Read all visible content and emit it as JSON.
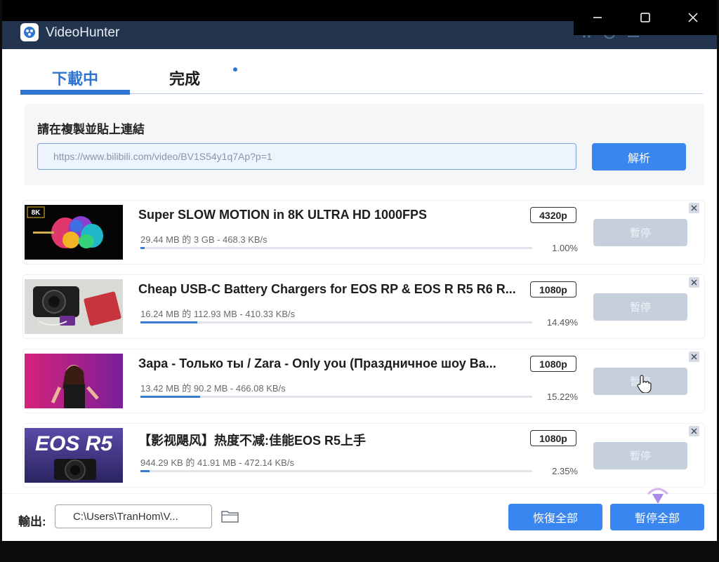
{
  "app": {
    "title": "VideoHunter"
  },
  "tabs": [
    {
      "label": "下載中",
      "active": true
    },
    {
      "label": "完成",
      "active": false
    }
  ],
  "paste": {
    "label": "請在複製並貼上連結",
    "url_value": "https://www.bilibili.com/video/BV1S54y1q7Ap?p=1",
    "analyze_label": "解析"
  },
  "tasks": [
    {
      "title": "Super SLOW MOTION in 8K ULTRA HD 1000FPS",
      "resolution": "4320p",
      "size_info": "29.44 MB 的 3 GB - 468.3 KB/s",
      "percent": "1.00%",
      "progress": 1.0,
      "pause_label": "暫停"
    },
    {
      "title": "Cheap USB-C Battery Chargers for EOS RP & EOS R R5 R6 R...",
      "resolution": "1080p",
      "size_info": "16.24 MB 的 112.93 MB - 410.33 KB/s",
      "percent": "14.49%",
      "progress": 14.49,
      "pause_label": "暫停"
    },
    {
      "title": "Зара - Только ты / Zara - Only you (Праздничное шоу Ва...",
      "resolution": "1080p",
      "size_info": "13.42 MB 的 90.2 MB - 466.08 KB/s",
      "percent": "15.22%",
      "progress": 15.22,
      "pause_label": "暫停"
    },
    {
      "title": "【影视飓风】热度不减:佳能EOS R5上手",
      "resolution": "1080p",
      "size_info": "944.29 KB 的 41.91 MB - 472.14 KB/s",
      "percent": "2.35%",
      "progress": 2.35,
      "pause_label": "暫停"
    }
  ],
  "thumbs": {
    "t1_badge": "8K",
    "t4_text": "EOS R5"
  },
  "bottom": {
    "output_label": "輸出:",
    "output_path": "C:\\Users\\TranHom\\V...",
    "resume_all_label": "恢復全部",
    "pause_all_label": "暫停全部"
  },
  "colors": {
    "accent": "#3a86f0",
    "titlebar": "#23354e",
    "disabled": "#c6d0dd"
  },
  "icons": [
    "app-logo-icon",
    "cart-icon",
    "user-icon",
    "menu-icon",
    "minimize-icon",
    "maximize-icon",
    "close-icon",
    "folder-icon",
    "remove-task-icon"
  ]
}
